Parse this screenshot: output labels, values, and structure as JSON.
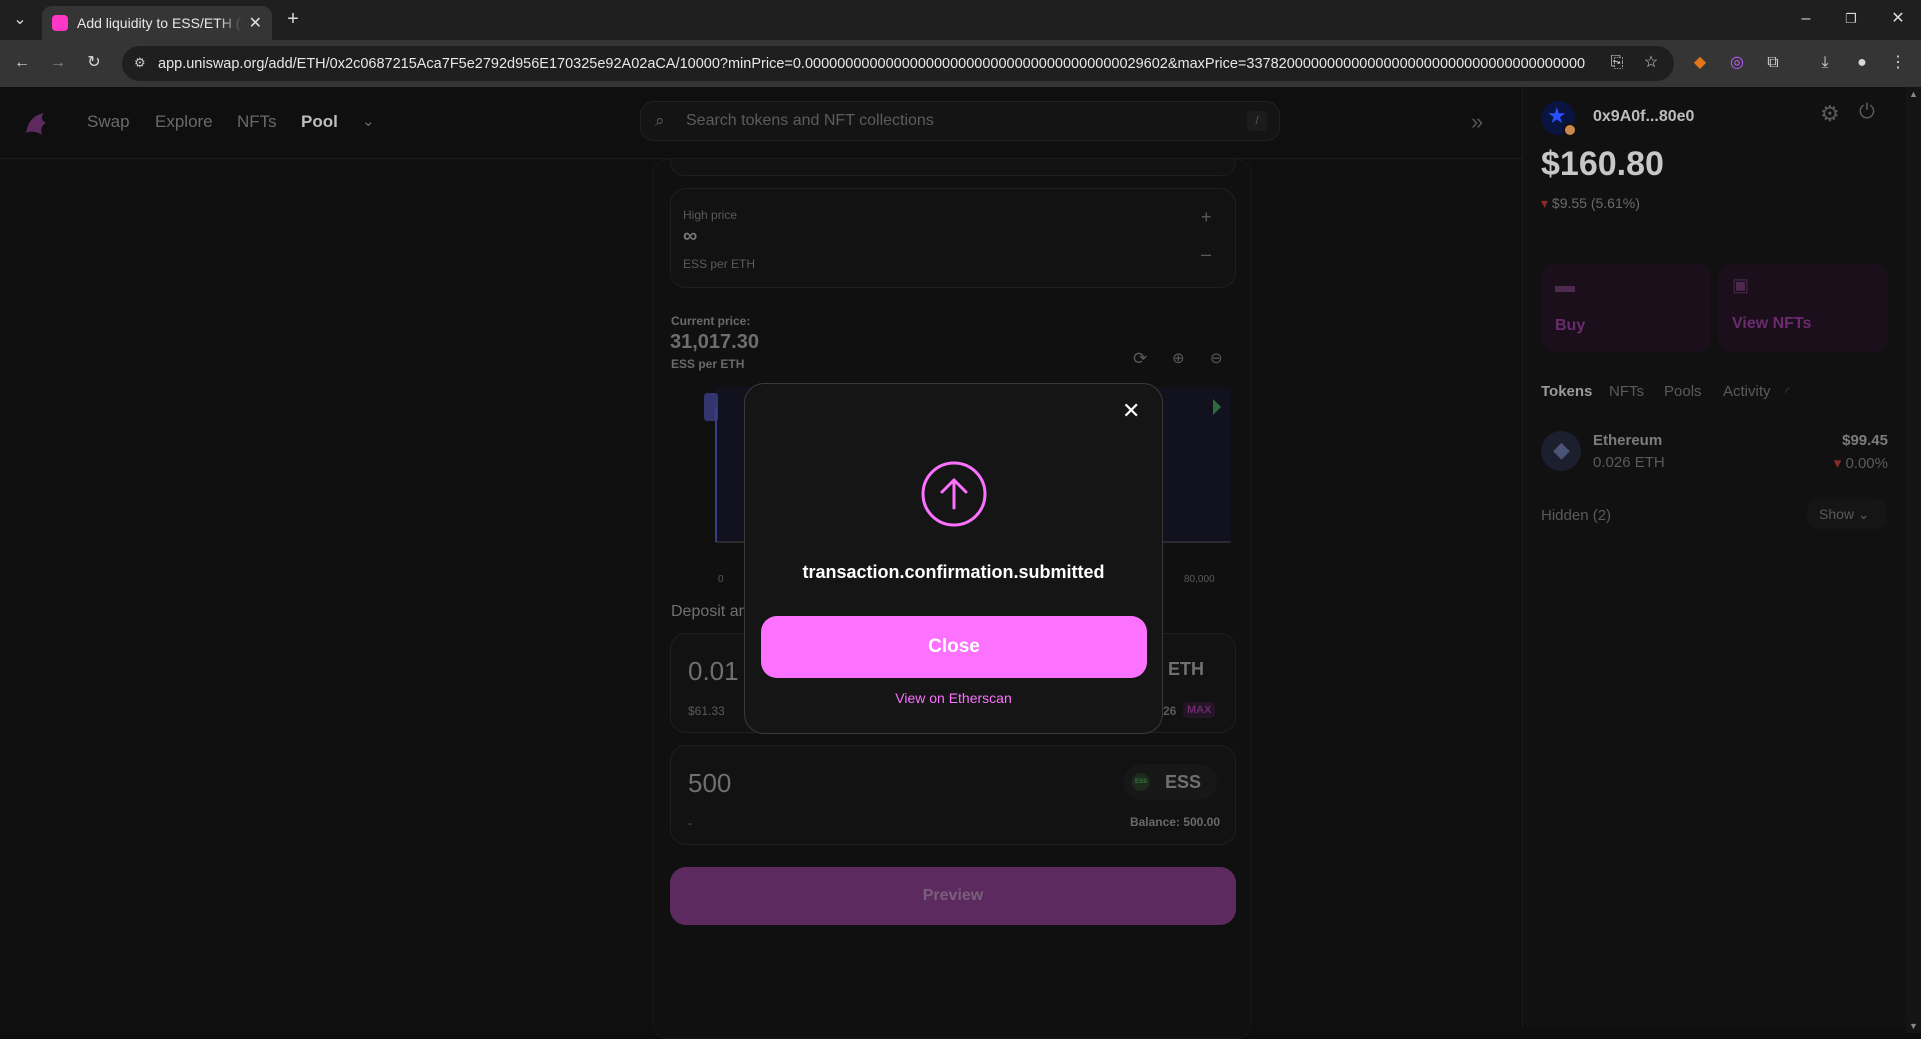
{
  "browser": {
    "tab_title": "Add liquidity to ESS/ETH (Ethereum)",
    "url": "app.uniswap.org/add/ETH/0x2c0687215Aca7F5e2792d956E170325e92A02aCA/10000?minPrice=0.000000000000000000000000000000000000000029602&maxPrice=337820000000000000000000000000000000000000"
  },
  "nav": {
    "links": [
      "Swap",
      "Explore",
      "NFTs",
      "Pool"
    ],
    "search_placeholder": "Search tokens and NFT collections",
    "search_shortcut": "/"
  },
  "range": {
    "high_label": "High price",
    "high_value": "∞",
    "high_unit": "ESS per ETH",
    "current_label": "Current price:",
    "current_value": "31,017.30",
    "current_unit": "ESS per ETH",
    "axis_min": "0",
    "axis_max": "80,000"
  },
  "deposit": {
    "title": "Deposit amounts",
    "eth_amount": "0.01",
    "eth_usd": "$61.33",
    "eth_symbol": "ETH",
    "eth_balance_suffix": "26",
    "max_label": "MAX",
    "ess_amount": "500",
    "ess_usd": "-",
    "ess_symbol": "ESS",
    "ess_badge": "ESS",
    "ess_balance": "Balance: 500.00",
    "preview_label": "Preview"
  },
  "modal": {
    "message": "transaction.confirmation.submitted",
    "close_label": "Close",
    "etherscan_label": "View on Etherscan"
  },
  "wallet": {
    "address": "0x9A0f...80e0",
    "balance": "$160.80",
    "change": "$9.55 (5.61%)",
    "buy_label": "Buy",
    "nfts_label": "View NFTs",
    "tabs": [
      "Tokens",
      "NFTs",
      "Pools",
      "Activity"
    ],
    "token_name": "Ethereum",
    "token_amount": "0.026 ETH",
    "token_value": "$99.45",
    "token_change": "0.00%",
    "hidden_label": "Hidden (2)",
    "show_label": "Show"
  },
  "colors": {
    "accent": "#fc72ff",
    "down": "#fd4040",
    "preview_bg": "#6b2b6e"
  }
}
